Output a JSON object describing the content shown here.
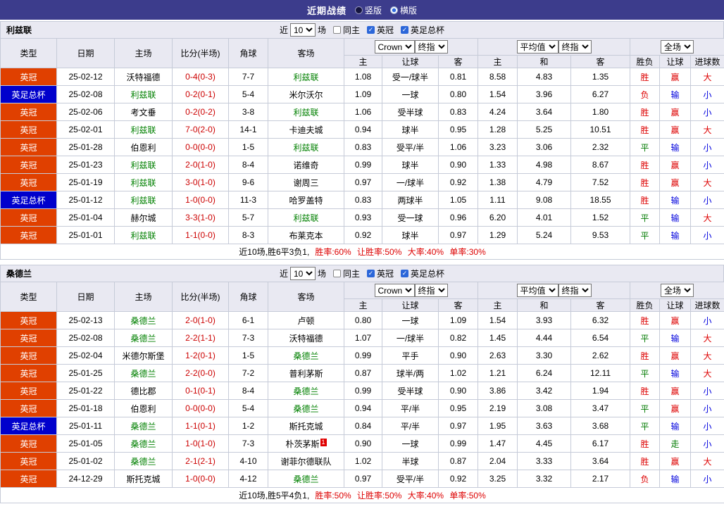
{
  "topbar": {
    "title": "近期战绩",
    "vertical_label": "竖版",
    "horizontal_label": "横版",
    "selected_layout": "横版"
  },
  "controls": {
    "near_label": "近",
    "count": "10",
    "matches_label": "场",
    "same_home": "同主",
    "league": "英冠",
    "facup": "英足总杯"
  },
  "header": {
    "cols": [
      "类型",
      "日期",
      "主场",
      "比分(半场)",
      "角球",
      "客场"
    ],
    "bookmaker": "Crown",
    "final_label": "终指",
    "average_label": "平均值",
    "scope_label": "全场",
    "asia_sub": [
      "主",
      "让球",
      "客"
    ],
    "euro_sub": [
      "主",
      "和",
      "客"
    ],
    "result_sub": [
      "胜负",
      "让球",
      "进球数"
    ]
  },
  "colors": {
    "topbar_bg": "#3c3c8c",
    "header_bg": "#e9e9f2",
    "grid": "#c6cbd8",
    "league_red": "#e04000",
    "cup_blue": "#0000cc",
    "focus_green": "#008000",
    "score_red": "#cc0000",
    "res_red": "#dd0000",
    "res_green": "#007a00",
    "res_blue": "#0000dd"
  },
  "sections": [
    {
      "team": "利兹联",
      "rows": [
        {
          "type": "英冠",
          "date": "25-02-12",
          "home": "沃特福德",
          "score": "0-4(0-3)",
          "corner": "7-7",
          "away": "利兹联",
          "asia": [
            "1.08",
            "受一/球半",
            "0.81"
          ],
          "euro": [
            "8.58",
            "4.83",
            "1.35"
          ],
          "result": [
            "胜",
            "赢",
            "大"
          ]
        },
        {
          "type": "英足总杯",
          "date": "25-02-08",
          "home": "利兹联",
          "score": "0-2(0-1)",
          "corner": "5-4",
          "away": "米尔沃尔",
          "asia": [
            "1.09",
            "一球",
            "0.80"
          ],
          "euro": [
            "1.54",
            "3.96",
            "6.27"
          ],
          "result": [
            "负",
            "输",
            "小"
          ]
        },
        {
          "type": "英冠",
          "date": "25-02-06",
          "home": "考文垂",
          "score": "0-2(0-2)",
          "corner": "3-8",
          "away": "利兹联",
          "asia": [
            "1.06",
            "受半球",
            "0.83"
          ],
          "euro": [
            "4.24",
            "3.64",
            "1.80"
          ],
          "result": [
            "胜",
            "赢",
            "小"
          ]
        },
        {
          "type": "英冠",
          "date": "25-02-01",
          "home": "利兹联",
          "score": "7-0(2-0)",
          "corner": "14-1",
          "away": "卡迪夫城",
          "asia": [
            "0.94",
            "球半",
            "0.95"
          ],
          "euro": [
            "1.28",
            "5.25",
            "10.51"
          ],
          "result": [
            "胜",
            "赢",
            "大"
          ]
        },
        {
          "type": "英冠",
          "date": "25-01-28",
          "home": "伯恩利",
          "score": "0-0(0-0)",
          "corner": "1-5",
          "away": "利兹联",
          "asia": [
            "0.83",
            "受平/半",
            "1.06"
          ],
          "euro": [
            "3.23",
            "3.06",
            "2.32"
          ],
          "result": [
            "平",
            "输",
            "小"
          ]
        },
        {
          "type": "英冠",
          "date": "25-01-23",
          "home": "利兹联",
          "score": "2-0(1-0)",
          "corner": "8-4",
          "away": "诺维奇",
          "asia": [
            "0.99",
            "球半",
            "0.90"
          ],
          "euro": [
            "1.33",
            "4.98",
            "8.67"
          ],
          "result": [
            "胜",
            "赢",
            "小"
          ]
        },
        {
          "type": "英冠",
          "date": "25-01-19",
          "home": "利兹联",
          "score": "3-0(1-0)",
          "corner": "9-6",
          "away": "谢周三",
          "asia": [
            "0.97",
            "一/球半",
            "0.92"
          ],
          "euro": [
            "1.38",
            "4.79",
            "7.52"
          ],
          "result": [
            "胜",
            "赢",
            "大"
          ]
        },
        {
          "type": "英足总杯",
          "date": "25-01-12",
          "home": "利兹联",
          "score": "1-0(0-0)",
          "corner": "11-3",
          "away": "哈罗盖特",
          "asia": [
            "0.83",
            "两球半",
            "1.05"
          ],
          "euro": [
            "1.11",
            "9.08",
            "18.55"
          ],
          "result": [
            "胜",
            "输",
            "小"
          ]
        },
        {
          "type": "英冠",
          "date": "25-01-04",
          "home": "赫尔城",
          "score": "3-3(1-0)",
          "corner": "5-7",
          "away": "利兹联",
          "asia": [
            "0.93",
            "受一球",
            "0.96"
          ],
          "euro": [
            "6.20",
            "4.01",
            "1.52"
          ],
          "result": [
            "平",
            "输",
            "大"
          ]
        },
        {
          "type": "英冠",
          "date": "25-01-01",
          "home": "利兹联",
          "score": "1-1(0-0)",
          "corner": "8-3",
          "away": "布莱克本",
          "asia": [
            "0.92",
            "球半",
            "0.97"
          ],
          "euro": [
            "1.29",
            "5.24",
            "9.53"
          ],
          "result": [
            "平",
            "输",
            "小"
          ]
        }
      ],
      "summary_prefix": "近10场,胜6平3负1,",
      "summary_stats": "胜率:60% 让胜率:50% 大率:40% 单率:30%"
    },
    {
      "team": "桑德兰",
      "rows": [
        {
          "type": "英冠",
          "date": "25-02-13",
          "home": "桑德兰",
          "score": "2-0(1-0)",
          "corner": "6-1",
          "away": "卢顿",
          "asia": [
            "0.80",
            "一球",
            "1.09"
          ],
          "euro": [
            "1.54",
            "3.93",
            "6.32"
          ],
          "result": [
            "胜",
            "赢",
            "小"
          ]
        },
        {
          "type": "英冠",
          "date": "25-02-08",
          "home": "桑德兰",
          "score": "2-2(1-1)",
          "corner": "7-3",
          "away": "沃特福德",
          "asia": [
            "1.07",
            "一/球半",
            "0.82"
          ],
          "euro": [
            "1.45",
            "4.44",
            "6.54"
          ],
          "result": [
            "平",
            "输",
            "大"
          ]
        },
        {
          "type": "英冠",
          "date": "25-02-04",
          "home": "米德尔斯堡",
          "score": "1-2(0-1)",
          "corner": "1-5",
          "away": "桑德兰",
          "asia": [
            "0.99",
            "平手",
            "0.90"
          ],
          "euro": [
            "2.63",
            "3.30",
            "2.62"
          ],
          "result": [
            "胜",
            "赢",
            "大"
          ]
        },
        {
          "type": "英冠",
          "date": "25-01-25",
          "home": "桑德兰",
          "score": "2-2(0-0)",
          "corner": "7-2",
          "away": "普利茅斯",
          "asia": [
            "0.87",
            "球半/两",
            "1.02"
          ],
          "euro": [
            "1.21",
            "6.24",
            "12.11"
          ],
          "result": [
            "平",
            "输",
            "大"
          ]
        },
        {
          "type": "英冠",
          "date": "25-01-22",
          "home": "德比郡",
          "score": "0-1(0-1)",
          "corner": "8-4",
          "away": "桑德兰",
          "asia": [
            "0.99",
            "受半球",
            "0.90"
          ],
          "euro": [
            "3.86",
            "3.42",
            "1.94"
          ],
          "result": [
            "胜",
            "赢",
            "小"
          ]
        },
        {
          "type": "英冠",
          "date": "25-01-18",
          "home": "伯恩利",
          "score": "0-0(0-0)",
          "corner": "5-4",
          "away": "桑德兰",
          "asia": [
            "0.94",
            "平/半",
            "0.95"
          ],
          "euro": [
            "2.19",
            "3.08",
            "3.47"
          ],
          "result": [
            "平",
            "赢",
            "小"
          ]
        },
        {
          "type": "英足总杯",
          "date": "25-01-11",
          "home": "桑德兰",
          "score": "1-1(0-1)",
          "corner": "1-2",
          "away": "斯托克城",
          "asia": [
            "0.84",
            "平/半",
            "0.97"
          ],
          "euro": [
            "1.95",
            "3.63",
            "3.68"
          ],
          "result": [
            "平",
            "输",
            "小"
          ]
        },
        {
          "type": "英冠",
          "date": "25-01-05",
          "home": "桑德兰",
          "score": "1-0(1-0)",
          "corner": "7-3",
          "away": "朴茨茅斯",
          "away_card": "1",
          "asia": [
            "0.90",
            "一球",
            "0.99"
          ],
          "euro": [
            "1.47",
            "4.45",
            "6.17"
          ],
          "result": [
            "胜",
            "走",
            "小"
          ]
        },
        {
          "type": "英冠",
          "date": "25-01-02",
          "home": "桑德兰",
          "score": "2-1(2-1)",
          "corner": "4-10",
          "away": "谢菲尔德联队",
          "asia": [
            "1.02",
            "半球",
            "0.87"
          ],
          "euro": [
            "2.04",
            "3.33",
            "3.64"
          ],
          "result": [
            "胜",
            "赢",
            "大"
          ]
        },
        {
          "type": "英冠",
          "date": "24-12-29",
          "home": "斯托克城",
          "score": "1-0(0-0)",
          "corner": "4-12",
          "away": "桑德兰",
          "asia": [
            "0.97",
            "受平/半",
            "0.92"
          ],
          "euro": [
            "3.25",
            "3.32",
            "2.17"
          ],
          "result": [
            "负",
            "输",
            "小"
          ]
        }
      ],
      "summary_prefix": "近10场,胜5平4负1,",
      "summary_stats": "胜率:50% 让胜率:50% 大率:40% 单率:50%"
    }
  ]
}
